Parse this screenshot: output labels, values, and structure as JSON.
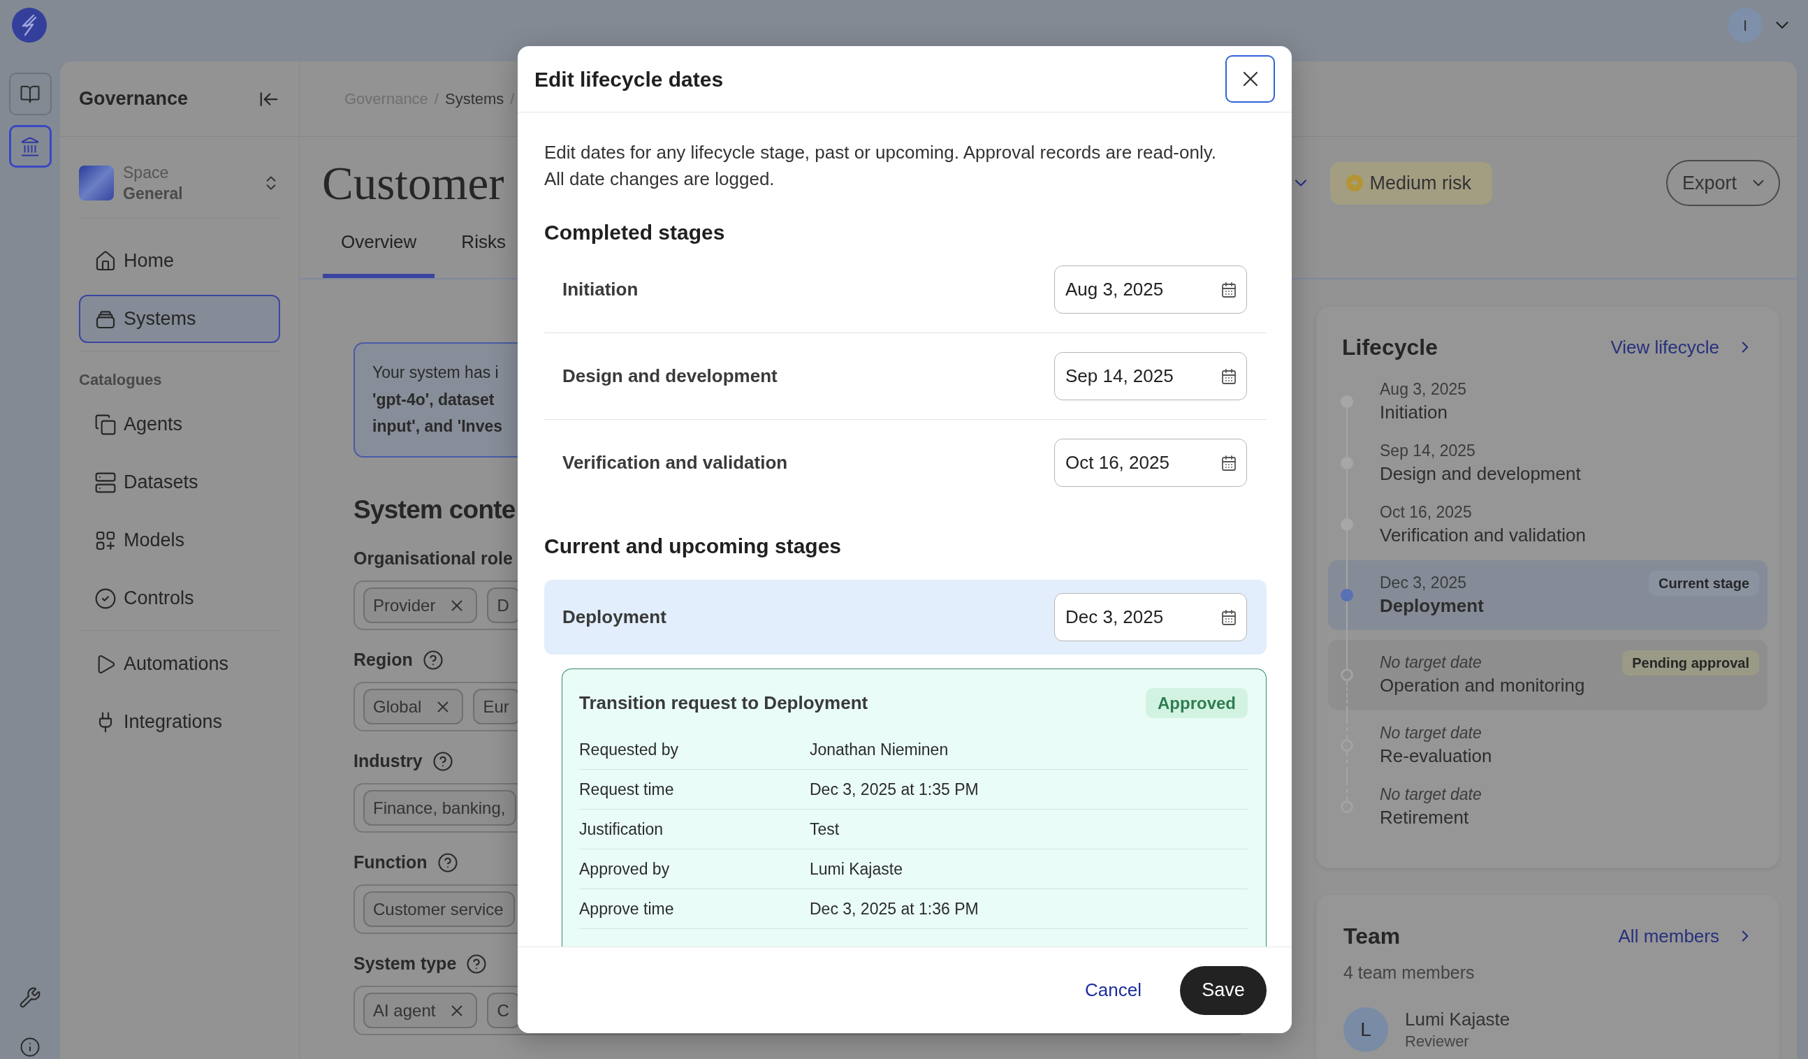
{
  "top_bar": {
    "avatar": "I"
  },
  "rail": {
    "buttons": [
      {
        "selected": false
      },
      {
        "selected": true
      }
    ]
  },
  "sidebar": {
    "title": "Governance",
    "space": {
      "label": "Space",
      "name": "General"
    },
    "groups": [
      {
        "items": [
          {
            "label": "Home",
            "selected": false
          },
          {
            "label": "Systems",
            "selected": true
          }
        ]
      },
      {
        "heading": "Catalogues",
        "items": [
          {
            "label": "Agents",
            "selected": false
          },
          {
            "label": "Datasets",
            "selected": false
          },
          {
            "label": "Models",
            "selected": false
          },
          {
            "label": "Controls",
            "selected": false
          }
        ]
      },
      {
        "items": [
          {
            "label": "Automations",
            "selected": false
          },
          {
            "label": "Integrations",
            "selected": false
          }
        ]
      }
    ]
  },
  "breadcrumb": {
    "items": [
      "Governance",
      "Systems"
    ],
    "separator": "/"
  },
  "header": {
    "title": "Customer",
    "risk": "Medium risk",
    "export": "Export"
  },
  "tabs": [
    {
      "label": "Overview",
      "selected": true
    },
    {
      "label": "Risks",
      "selected": false
    }
  ],
  "notice": {
    "lines": [
      "Your system has i",
      "**'gpt-4o', dataset**",
      "**input', and 'Inves**"
    ]
  },
  "system_context": {
    "heading": "System conte",
    "fields": [
      {
        "label": "Organisational role",
        "help": false,
        "chips": [
          {
            "label": "Provider",
            "removable": true
          },
          {
            "label": "D",
            "removable": false
          }
        ]
      },
      {
        "label": "Region",
        "help": true,
        "chips": [
          {
            "label": "Global",
            "removable": true
          },
          {
            "label": "Eur",
            "removable": false
          }
        ]
      },
      {
        "label": "Industry",
        "help": true,
        "chips": [
          {
            "label": "Finance, banking,",
            "removable": false
          }
        ]
      },
      {
        "label": "Function",
        "help": true,
        "chips": [
          {
            "label": "Customer service",
            "removable": false
          }
        ]
      },
      {
        "label": "System type",
        "help": true,
        "chips": [
          {
            "label": "AI agent",
            "removable": true
          },
          {
            "label": "C",
            "removable": false
          }
        ]
      }
    ]
  },
  "lifecycle": {
    "title": "Lifecycle",
    "link": "View lifecycle",
    "stages": [
      {
        "date": "Aug 3, 2025",
        "name": "Initiation",
        "kind": "completed"
      },
      {
        "date": "Sep 14, 2025",
        "name": "Design and development",
        "kind": "completed"
      },
      {
        "date": "Oct 16, 2025",
        "name": "Verification and validation",
        "kind": "completed"
      },
      {
        "date": "Dec 3, 2025",
        "name": "Deployment",
        "kind": "current",
        "badge": "Current stage"
      },
      {
        "date": "No target date",
        "name": "Operation and monitoring",
        "kind": "pending",
        "badge": "Pending approval"
      },
      {
        "date": "No target date",
        "name": "Re-evaluation",
        "kind": "upcoming"
      },
      {
        "date": "No target date",
        "name": "Retirement",
        "kind": "upcoming"
      }
    ]
  },
  "team": {
    "title": "Team",
    "link": "All members",
    "count": "4 team members",
    "members": [
      {
        "initial": "L",
        "name": "Lumi Kajaste",
        "role": "Reviewer"
      }
    ]
  },
  "dialog": {
    "title": "Edit lifecycle dates",
    "description": "Edit dates for any lifecycle stage, past or upcoming. Approval records are read-only. All date changes are logged.",
    "sections": [
      {
        "heading": "Completed stages",
        "stages": [
          {
            "name": "Initiation",
            "date": "Aug 3, 2025",
            "current": false
          },
          {
            "name": "Design and development",
            "date": "Sep 14, 2025",
            "current": false
          },
          {
            "name": "Verification and validation",
            "date": "Oct 16, 2025",
            "current": false
          }
        ]
      },
      {
        "heading": "Current and upcoming stages",
        "stages": [
          {
            "name": "Deployment",
            "date": "Dec 3, 2025",
            "current": true,
            "transition": {
              "title": "Transition request to Deployment",
              "status": "Approved",
              "details": [
                {
                  "label": "Requested by",
                  "value": "Jonathan Nieminen"
                },
                {
                  "label": "Request time",
                  "value": "Dec 3, 2025 at 1:35 PM"
                },
                {
                  "label": "Justification",
                  "value": "Test"
                },
                {
                  "label": "Approved by",
                  "value": "Lumi Kajaste"
                },
                {
                  "label": "Approve time",
                  "value": "Dec 3, 2025 at 1:36 PM"
                }
              ]
            }
          }
        ]
      }
    ],
    "cancel": "Cancel",
    "save": "Save"
  }
}
